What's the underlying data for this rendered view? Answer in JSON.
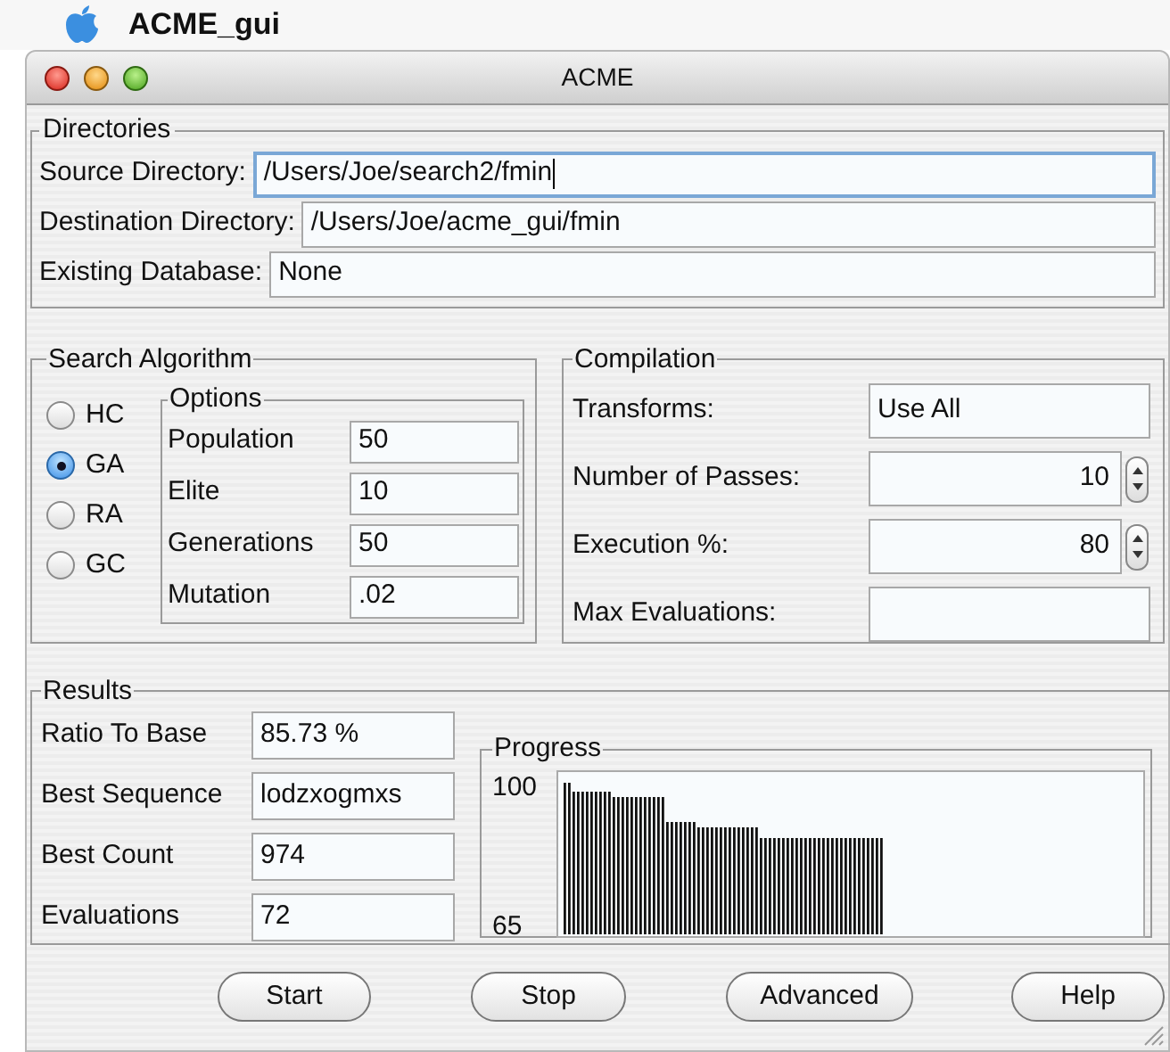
{
  "menu_bar": {
    "app_name": "ACME_gui"
  },
  "window": {
    "title": "ACME"
  },
  "directories": {
    "title": "Directories",
    "fields": [
      {
        "label": "Source Directory:",
        "value": "/Users/Joe/search2/fmin",
        "focused": true
      },
      {
        "label": "Destination Directory:",
        "value": "/Users/Joe/acme_gui/fmin",
        "focused": false
      },
      {
        "label": "Existing Database:",
        "value": "None",
        "focused": false
      }
    ]
  },
  "search_algorithm": {
    "title": "Search Algorithm",
    "radios": [
      {
        "label": "HC",
        "selected": false
      },
      {
        "label": "GA",
        "selected": true
      },
      {
        "label": "RA",
        "selected": false
      },
      {
        "label": "GC",
        "selected": false
      }
    ],
    "options": {
      "title": "Options",
      "fields": [
        {
          "label": "Population",
          "value": "50"
        },
        {
          "label": "Elite",
          "value": "10"
        },
        {
          "label": "Generations",
          "value": "50"
        },
        {
          "label": "Mutation",
          "value": ".02"
        }
      ]
    }
  },
  "compilation": {
    "title": "Compilation",
    "fields": [
      {
        "kind": "text",
        "label": "Transforms:",
        "value": "Use All"
      },
      {
        "kind": "spinner",
        "label": "Number of Passes:",
        "value": "10"
      },
      {
        "kind": "spinner",
        "label": "Execution %:",
        "value": "80"
      },
      {
        "kind": "text",
        "label": "Max Evaluations:"
      }
    ]
  },
  "results": {
    "title": "Results",
    "fields": [
      {
        "label": "Ratio To Base",
        "value": "85.73 %"
      },
      {
        "label": "Best Sequence",
        "value": "lodzxogmxs"
      },
      {
        "label": "Best Count",
        "value": "974"
      },
      {
        "label": "Evaluations",
        "value": "72"
      }
    ],
    "progress": {
      "title": "Progress",
      "axis_top_label": "100",
      "axis_bottom_label": "65"
    }
  },
  "buttons": [
    "Start",
    "Stop",
    "Advanced",
    "Help"
  ]
}
